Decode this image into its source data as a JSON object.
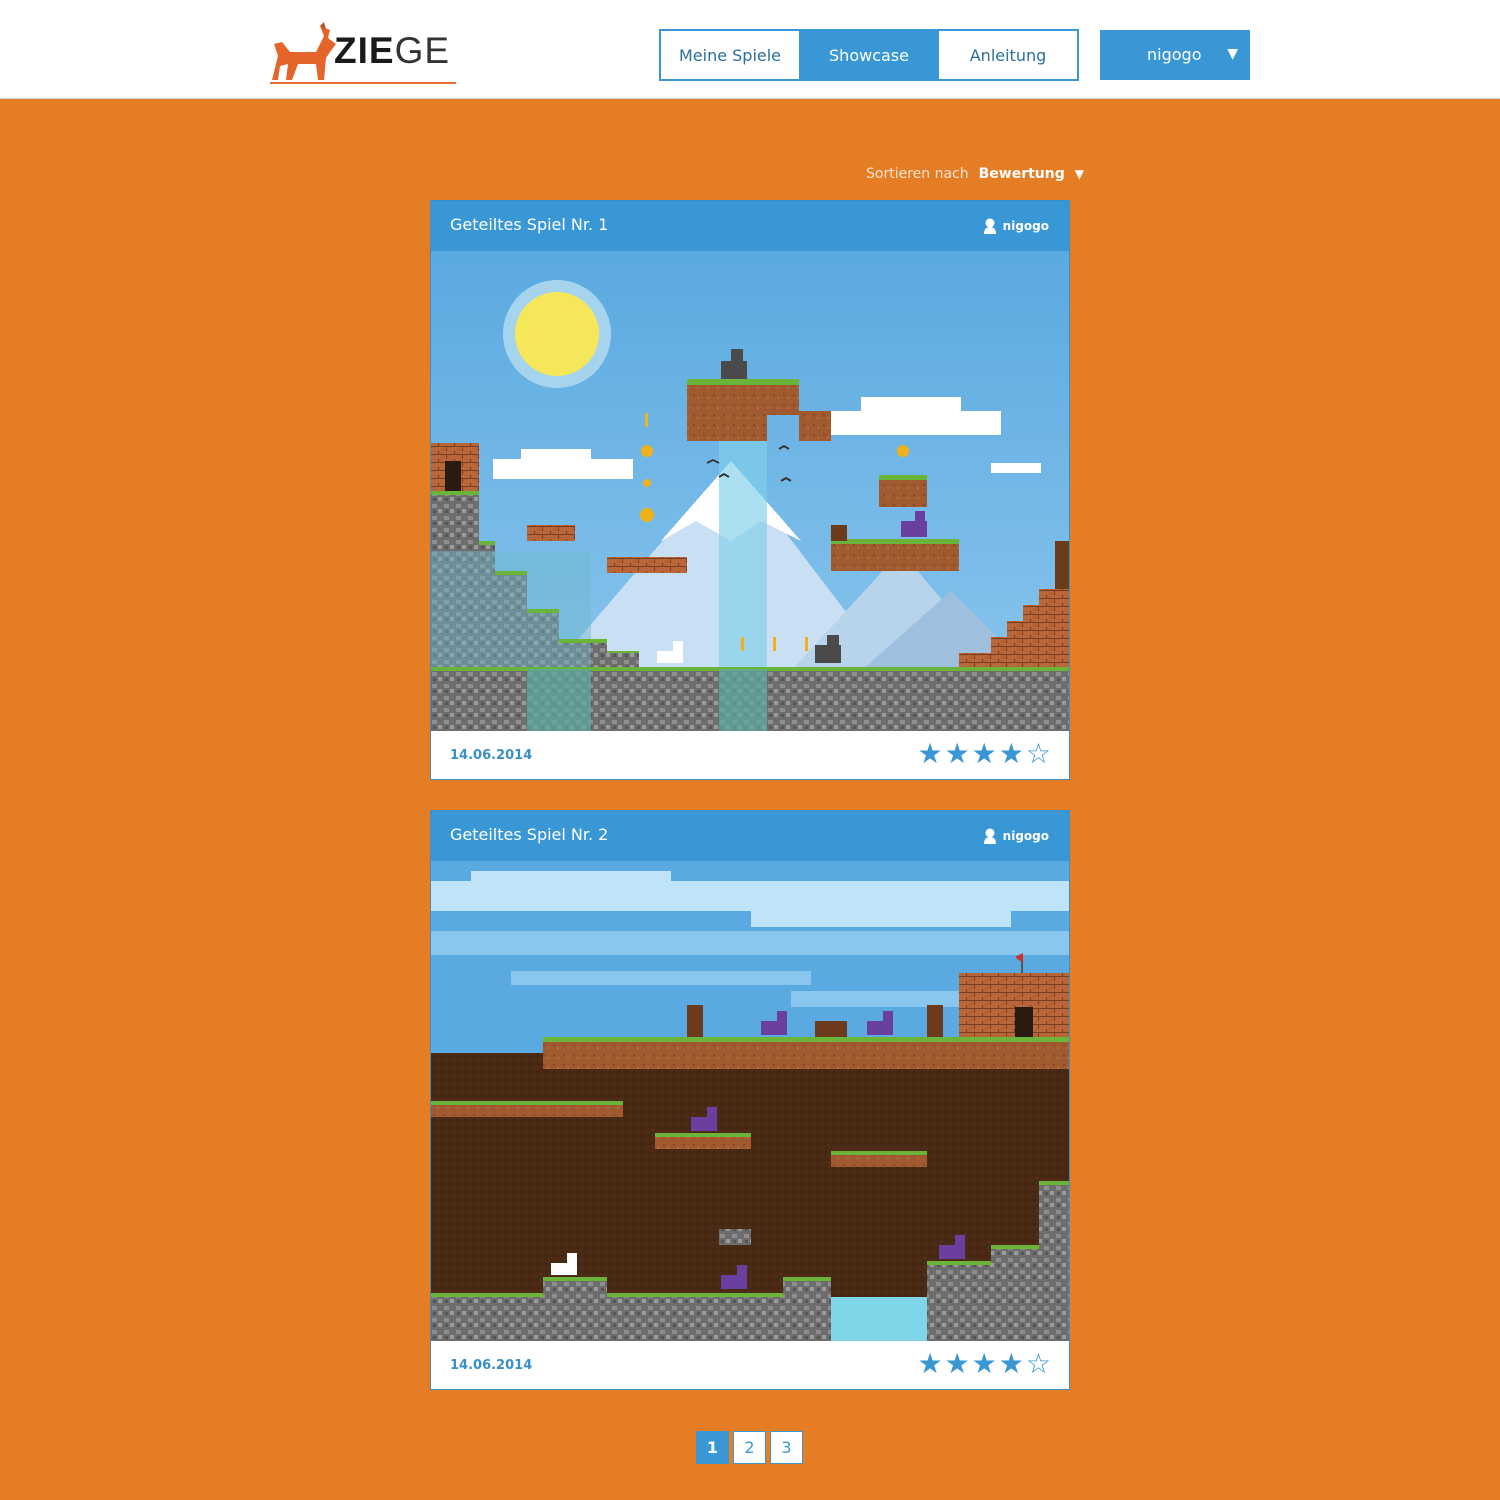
{
  "brand": {
    "logo_text": "ZIEGE"
  },
  "nav": {
    "tabs": [
      {
        "label": "Meine Spiele"
      },
      {
        "label": "Showcase"
      },
      {
        "label": "Anleitung"
      }
    ],
    "active_tab": "Showcase"
  },
  "user": {
    "name": "nigogo",
    "menu_icon": "caret-down-icon"
  },
  "sort": {
    "label": "Sortieren nach",
    "value": "Bewertung"
  },
  "cards": [
    {
      "title": "Geteiltes Spiel Nr. 1",
      "author": "nigogo",
      "date": "14.06.2014",
      "rating": 4,
      "rating_max": 5
    },
    {
      "title": "Geteiltes Spiel Nr. 2",
      "author": "nigogo",
      "date": "14.06.2014",
      "rating": 4,
      "rating_max": 5
    }
  ],
  "pagination": {
    "pages": [
      "1",
      "2",
      "3"
    ],
    "current": "1"
  },
  "colors": {
    "background": "#e57d25",
    "accent": "#3997d5"
  }
}
